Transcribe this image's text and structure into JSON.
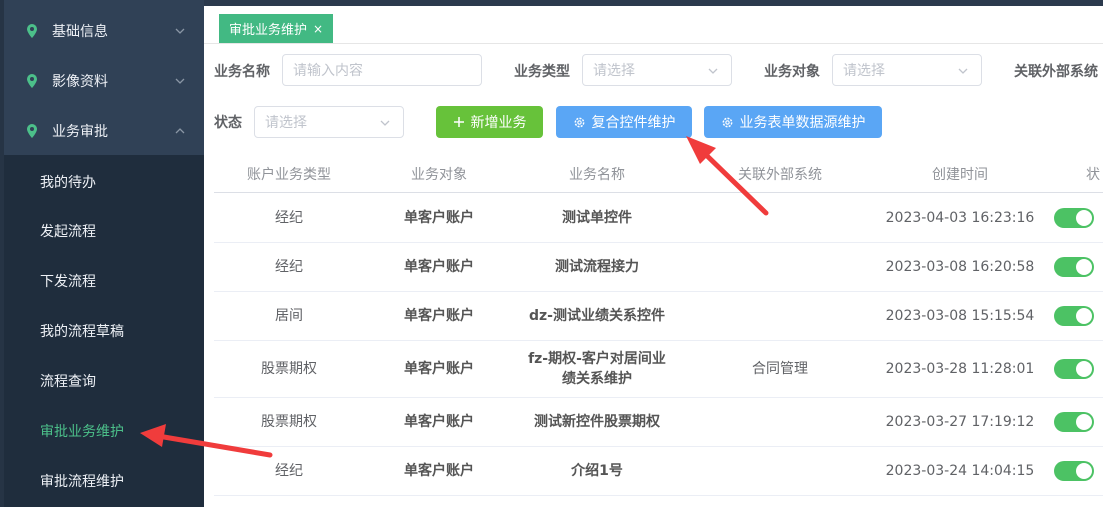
{
  "sidebar": {
    "menus": [
      {
        "label": "基础信息",
        "expanded": false
      },
      {
        "label": "影像资料",
        "expanded": false
      },
      {
        "label": "业务审批",
        "expanded": true
      }
    ],
    "subitems": [
      "我的待办",
      "发起流程",
      "下发流程",
      "我的流程草稿",
      "流程查询",
      "审批业务维护",
      "审批流程维护"
    ],
    "active_subitem": "审批业务维护"
  },
  "tabs": [
    {
      "label": "审批业务维护",
      "close": "×"
    }
  ],
  "filters": {
    "business_name": {
      "label": "业务名称",
      "placeholder": "请输入内容"
    },
    "business_type": {
      "label": "业务类型",
      "placeholder": "请选择"
    },
    "business_object": {
      "label": "业务对象",
      "placeholder": "请选择"
    },
    "external_system": {
      "label": "关联外部系统"
    },
    "status": {
      "label": "状态",
      "placeholder": "请选择"
    }
  },
  "buttons": {
    "add": "新增业务",
    "composite": "复合控件维护",
    "datasource": "业务表单数据源维护"
  },
  "table": {
    "columns": [
      "账户业务类型",
      "业务对象",
      "业务名称",
      "关联外部系统",
      "创建时间",
      "状"
    ],
    "rows": [
      {
        "type": "经纪",
        "object": "单客户账户",
        "name": "测试单控件",
        "system": "",
        "created": "2023-04-03 16:23:16",
        "enabled": true
      },
      {
        "type": "经纪",
        "object": "单客户账户",
        "name": "测试流程接力",
        "system": "",
        "created": "2023-03-08 16:20:58",
        "enabled": true
      },
      {
        "type": "居间",
        "object": "单客户账户",
        "name": "dz-测试业绩关系控件",
        "system": "",
        "created": "2023-03-08 15:15:54",
        "enabled": true
      },
      {
        "type": "股票期权",
        "object": "单客户账户",
        "name": "fz-期权-客户对居间业绩关系维护",
        "name_line1": "fz-期权-客户对居间业",
        "name_line2": "绩关系维护",
        "system": "合同管理",
        "created": "2023-03-28 11:28:01",
        "enabled": true
      },
      {
        "type": "股票期权",
        "object": "单客户账户",
        "name": "测试新控件股票期权",
        "system": "",
        "created": "2023-03-27 17:19:12",
        "enabled": true
      },
      {
        "type": "经纪",
        "object": "单客户账户",
        "name": "介绍1号",
        "system": "",
        "created": "2023-03-24 14:04:15",
        "enabled": true
      }
    ]
  },
  "colors": {
    "sidebar_bg": "#304156",
    "submenu_bg": "#1f2d3d",
    "active_text": "#4cc08a",
    "tab_bg": "#42b983",
    "btn_green": "#67c23a",
    "btn_blue": "#5aa6f5",
    "switch_on": "#4cc264",
    "annotation_arrow": "#f03c3c"
  }
}
